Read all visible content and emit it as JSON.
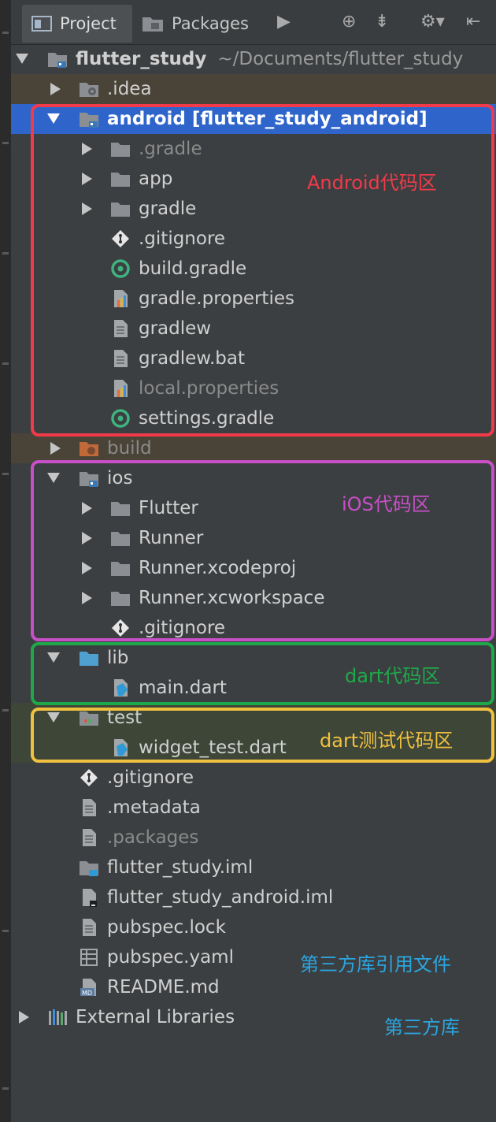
{
  "toolbar": {
    "tab_project": "Project",
    "tab_packages": "Packages"
  },
  "tree": {
    "root_name": "flutter_study",
    "root_path": "~/Documents/flutter_study",
    "idea": ".idea",
    "android": "android [flutter_study_android]",
    "android_children": {
      "gradle_dir": ".gradle",
      "app": "app",
      "gradle": "gradle",
      "gitignore": ".gitignore",
      "build_gradle": "build.gradle",
      "gradle_properties": "gradle.properties",
      "gradlew": "gradlew",
      "gradlew_bat": "gradlew.bat",
      "local_properties": "local.properties",
      "settings_gradle": "settings.gradle"
    },
    "build": "build",
    "ios": "ios",
    "ios_children": {
      "flutter": "Flutter",
      "runner": "Runner",
      "xcodeproj": "Runner.xcodeproj",
      "xcworkspace": "Runner.xcworkspace",
      "gitignore": ".gitignore"
    },
    "lib": "lib",
    "main_dart": "main.dart",
    "test": "test",
    "widget_test": "widget_test.dart",
    "root_files": {
      "gitignore": ".gitignore",
      "metadata": ".metadata",
      "packages": ".packages",
      "iml": "flutter_study.iml",
      "android_iml": "flutter_study_android.iml",
      "pubspec_lock": "pubspec.lock",
      "pubspec_yaml": "pubspec.yaml",
      "readme": "README.md"
    },
    "external_libraries": "External Libraries"
  },
  "annotations": {
    "android": "Android代码区",
    "ios": "iOS代码区",
    "dart": "dart代码区",
    "dart_test": "dart测试代码区",
    "pubspec": "第三方库引用文件",
    "external": "第三方库"
  },
  "colors": {
    "android_box": "#f23a4a",
    "ios_box": "#c84fc8",
    "dart_box": "#1fa84a",
    "test_box": "#f0c040",
    "pubspec_note": "#2aa6e0",
    "selection": "#2f65ca",
    "background": "#3c3f41"
  },
  "icons": [
    "project-icon",
    "packages-icon",
    "play-icon",
    "locate-icon",
    "collapse-icon",
    "gear-icon",
    "hide-icon",
    "folder-icon",
    "file-icon",
    "git-icon",
    "gradle-icon",
    "properties-icon",
    "dart-icon",
    "library-icon"
  ]
}
